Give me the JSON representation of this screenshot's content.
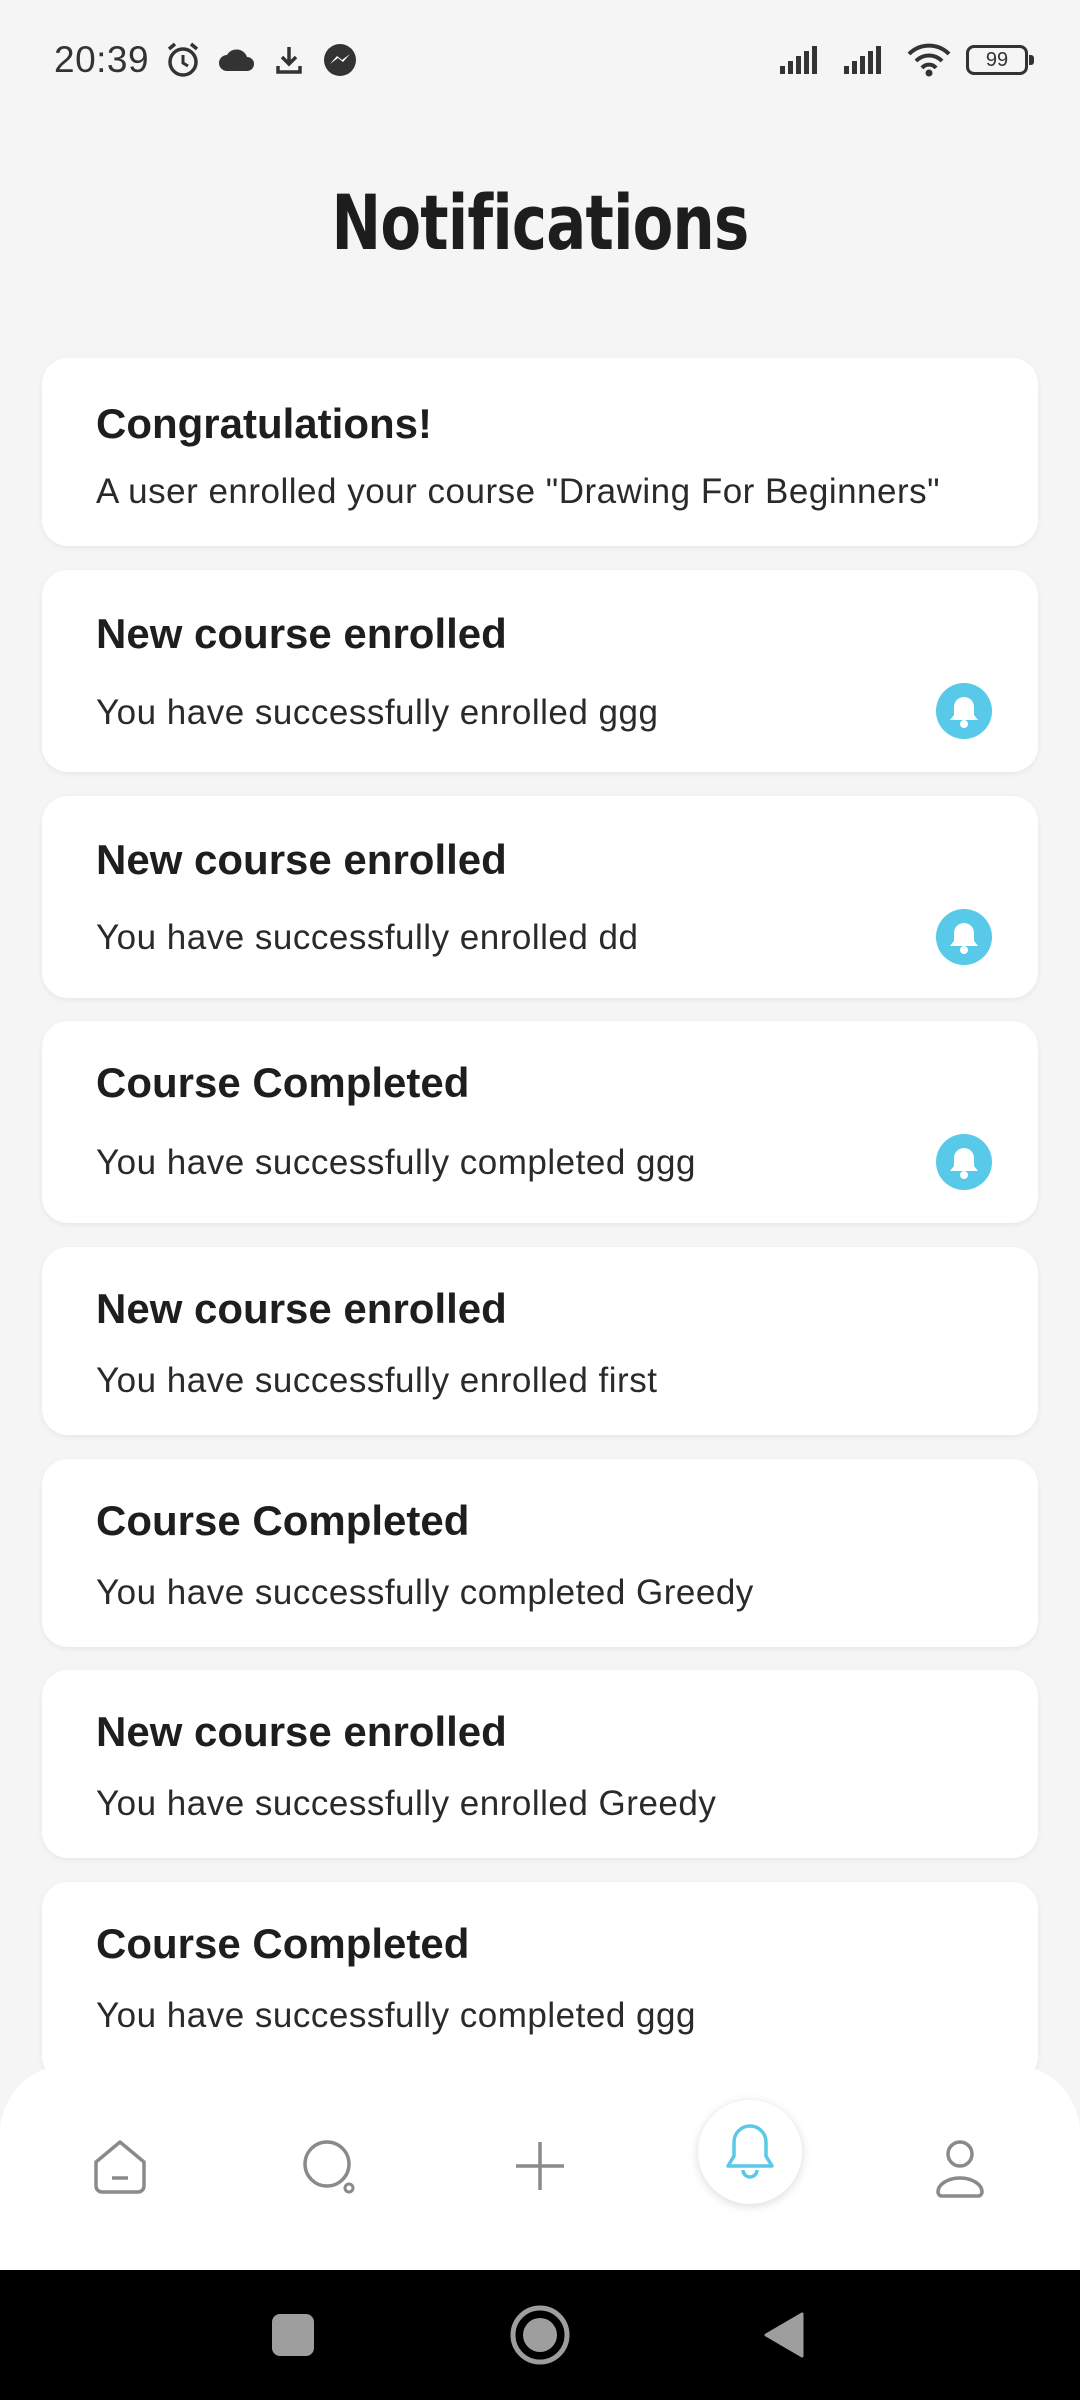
{
  "status_bar": {
    "time": "20:39",
    "battery": "99",
    "icons": [
      "alarm-icon",
      "cloud-icon",
      "download-icon",
      "messenger-icon",
      "signal-icon",
      "signal-icon",
      "wifi-icon",
      "battery-icon"
    ]
  },
  "header": {
    "title": "Notifications"
  },
  "notifications": [
    {
      "title": "Congratulations!",
      "message": "A user enrolled your course \"Drawing For Beginners\"",
      "unread": false
    },
    {
      "title": "New course enrolled",
      "message": "You have successfully enrolled ggg",
      "unread": true
    },
    {
      "title": "New course enrolled",
      "message": "You have successfully enrolled dd",
      "unread": true
    },
    {
      "title": "Course Completed",
      "message": "You have successfully completed ggg",
      "unread": true
    },
    {
      "title": "New course enrolled",
      "message": "You have successfully enrolled first",
      "unread": false
    },
    {
      "title": "Course Completed",
      "message": "You have successfully completed Greedy",
      "unread": false
    },
    {
      "title": "New course enrolled",
      "message": "You have successfully enrolled Greedy",
      "unread": false
    },
    {
      "title": "Course Completed",
      "message": "You have successfully completed ggg",
      "unread": false
    }
  ],
  "bottom_nav": {
    "items": [
      "home-icon",
      "search-icon",
      "add-icon",
      "bell-icon",
      "profile-icon"
    ],
    "active": "bell-icon"
  },
  "colors": {
    "accent": "#58c9e8",
    "background": "#f5f5f5",
    "card": "#ffffff"
  }
}
